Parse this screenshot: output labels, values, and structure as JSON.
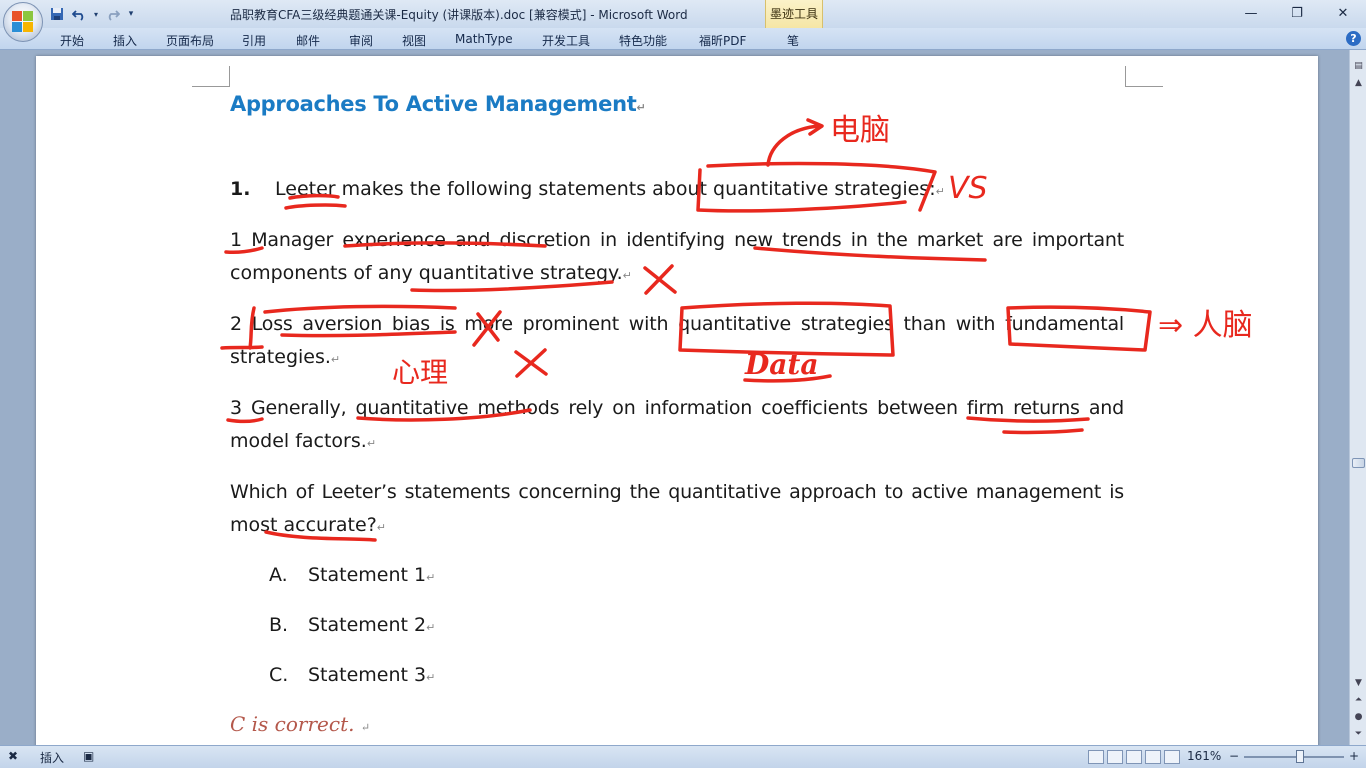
{
  "window": {
    "title": "品职教育CFA三级经典题通关课-Equity (讲课版本).doc [兼容模式] - Microsoft Word",
    "contextual_tab": "墨迹工具",
    "minimize": "—",
    "restore": "❐",
    "close": "✕"
  },
  "ribbon": {
    "tabs": [
      "开始",
      "插入",
      "页面布局",
      "引用",
      "邮件",
      "审阅",
      "视图",
      "MathType",
      "开发工具",
      "特色功能",
      "福昕PDF",
      "笔"
    ],
    "help": "?"
  },
  "document": {
    "heading": "Approaches To Active Management",
    "question_number": "1.",
    "question_intro": "Leeter makes the following statements about quantitative strategies:",
    "statement1_line1": "1 Manager experience and discretion in identifying new trends in the market are important",
    "statement1_line2": "components of any quantitative strategy.",
    "statement2_line1": "2 Loss aversion bias is more prominent with quantitative strategies than with fundamental",
    "statement2_line2": "strategies.",
    "statement3_line1": "3 Generally, quantitative methods rely on information coefficients between firm returns and",
    "statement3_line2": "model factors.",
    "prompt_line1": "Which of Leeter’s statements concerning the quantitative approach to active management is",
    "prompt_line2": "most accurate?",
    "options": [
      {
        "letter": "A.",
        "text": "Statement 1"
      },
      {
        "letter": "B.",
        "text": "Statement 2"
      },
      {
        "letter": "C.",
        "text": "Statement 3"
      }
    ],
    "answer": "C is correct.",
    "para_mark": "↵"
  },
  "ink_annotations": {
    "note_top": "电脑",
    "note_vs": "VS",
    "note_right": "⇒ 人脑",
    "note_psych": "心理",
    "note_data": "Data",
    "cross": "✕",
    "ink_color": "#e8281e"
  },
  "statusbar": {
    "mode": "插入",
    "zoom": "161%",
    "zoom_out": "−",
    "zoom_in": "+"
  }
}
